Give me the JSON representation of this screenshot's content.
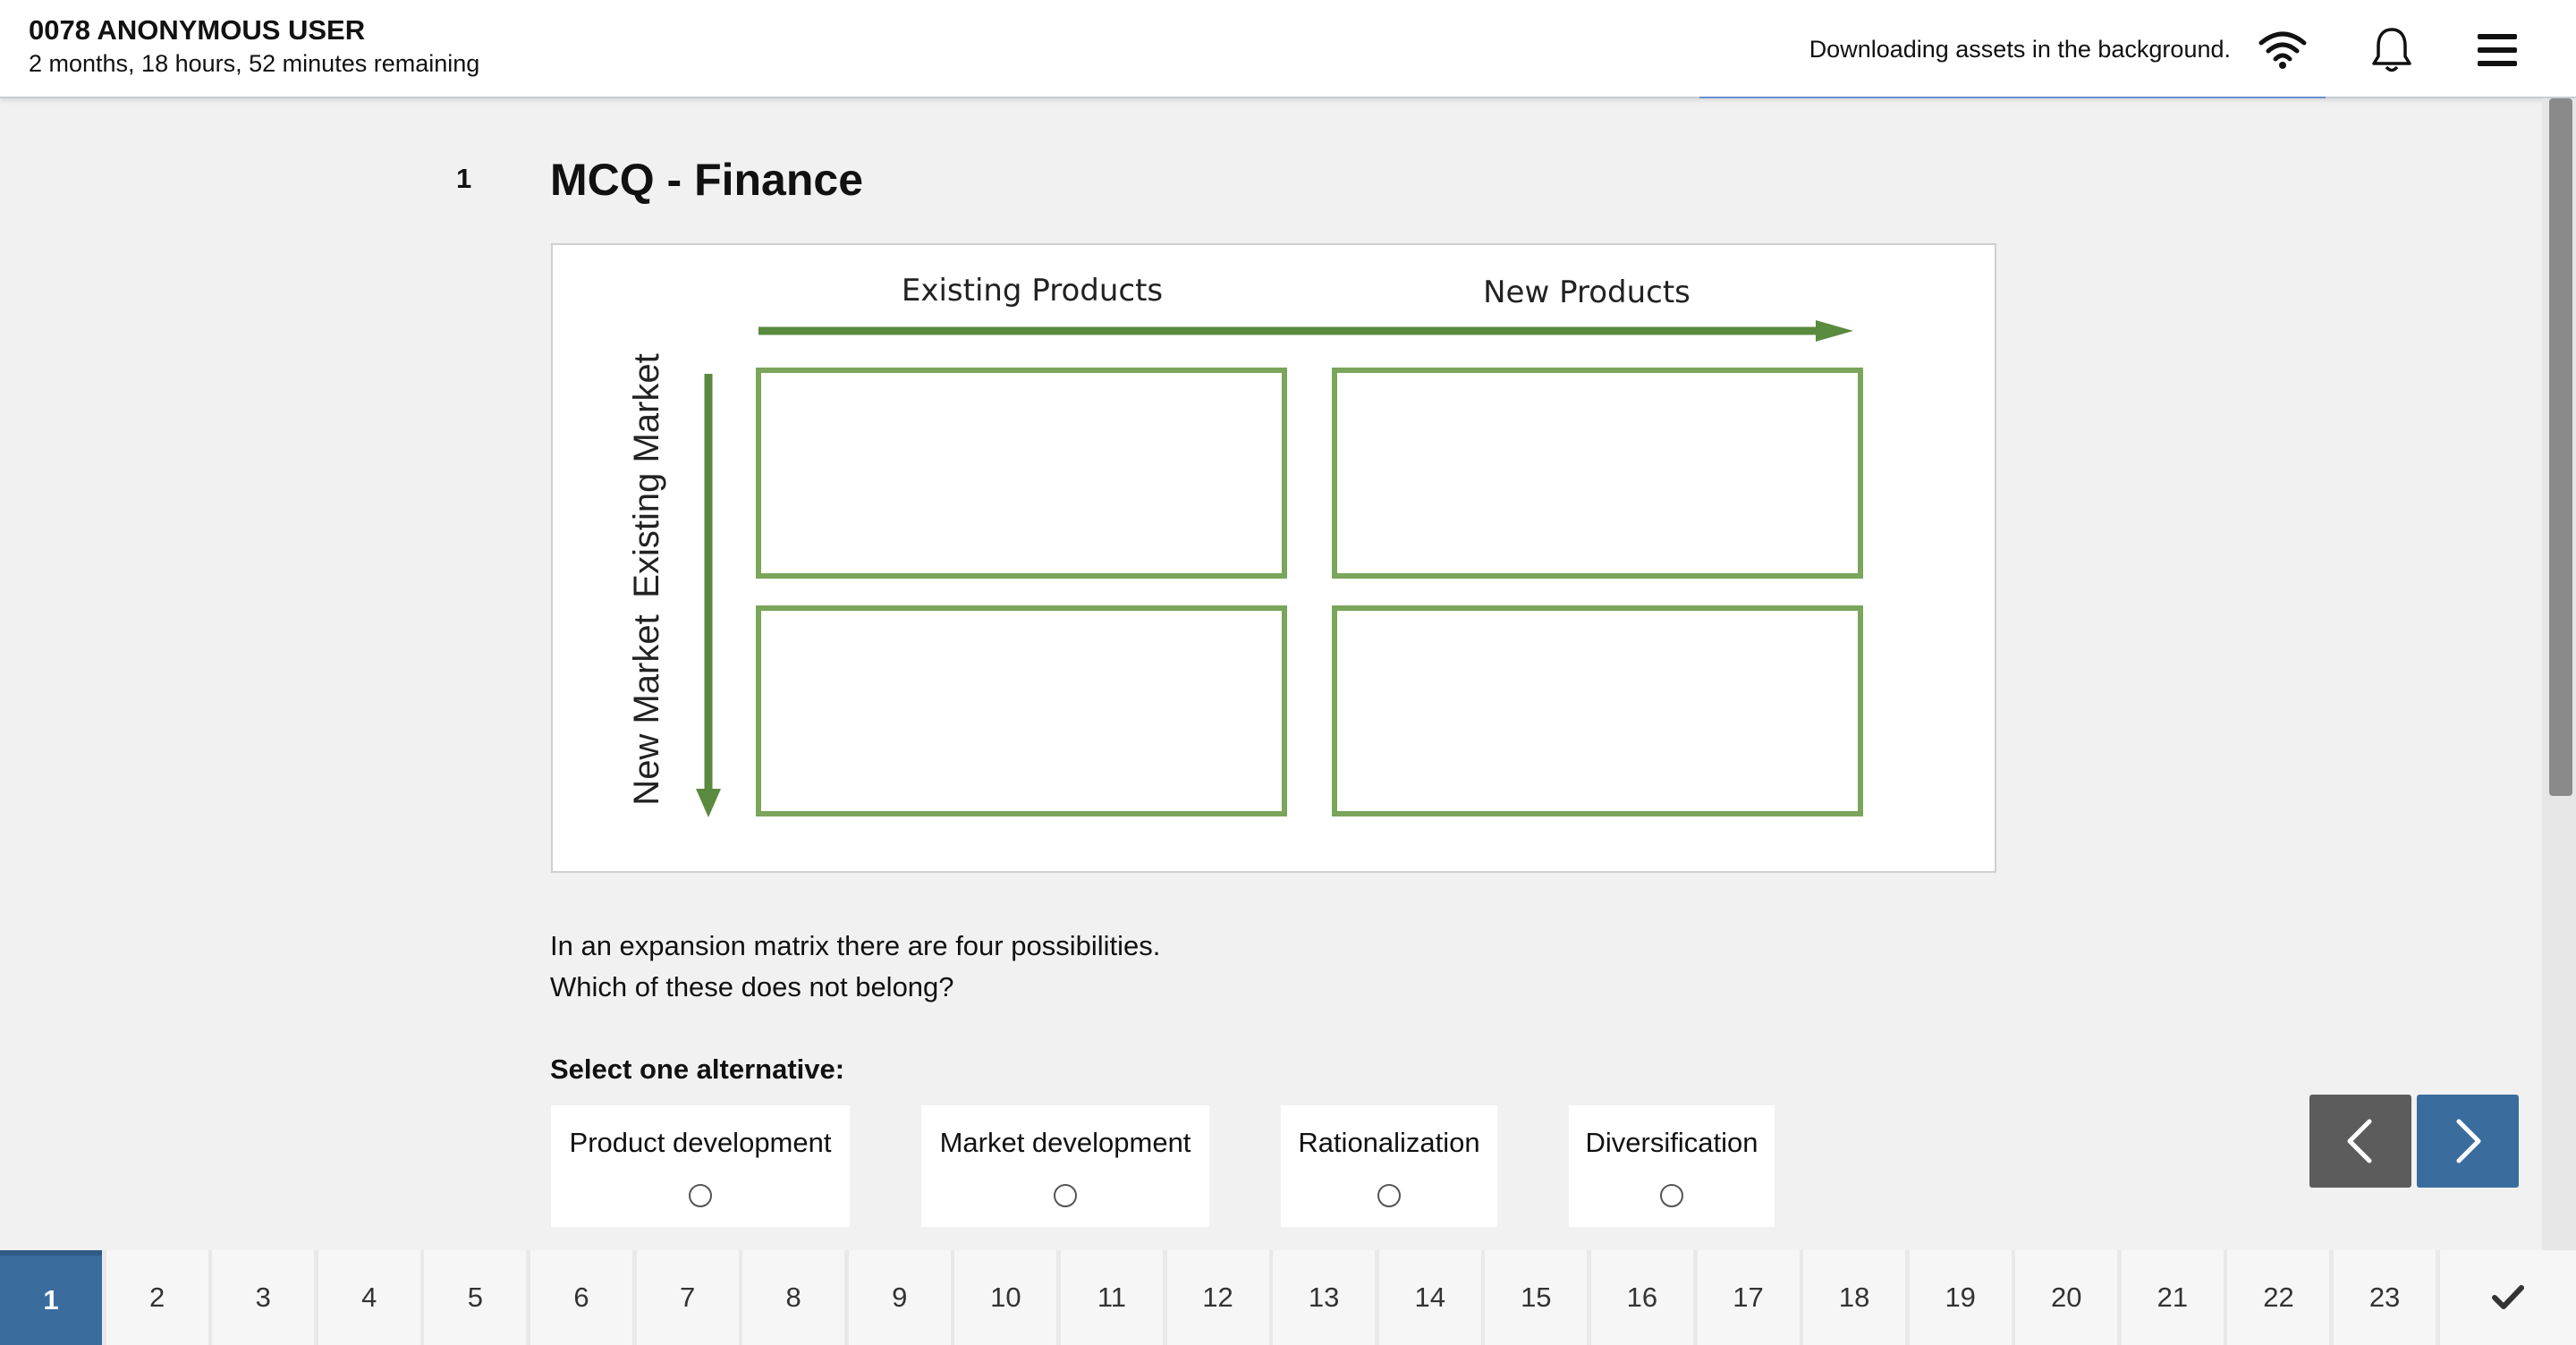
{
  "header": {
    "user_name": "0078 ANONYMOUS USER",
    "time_remaining": "2 months, 18 hours, 52 minutes remaining",
    "download_status": "Downloading assets in the background."
  },
  "question": {
    "number": "1",
    "title": "MCQ - Finance",
    "matrix": {
      "col_headers": [
        "Existing Products",
        "New Products"
      ],
      "row_headers": [
        "Existing Market",
        "New Market"
      ]
    },
    "text_line1": "In an expansion matrix there are four possibilities.",
    "text_line2": "Which of these does not belong?",
    "select_label": "Select one alternative:",
    "options": [
      "Product development",
      "Market development",
      "Rationalization",
      "Diversification"
    ]
  },
  "pager": {
    "pages": [
      "1",
      "2",
      "3",
      "4",
      "5",
      "6",
      "7",
      "8",
      "9",
      "10",
      "11",
      "12",
      "13",
      "14",
      "15",
      "16",
      "17",
      "18",
      "19",
      "20",
      "21",
      "22",
      "23"
    ],
    "active_page": "1"
  },
  "colors": {
    "accent": "#3a6d9e",
    "matrix_green": "#7aa55a",
    "arrow_green": "#5a8a3e"
  }
}
